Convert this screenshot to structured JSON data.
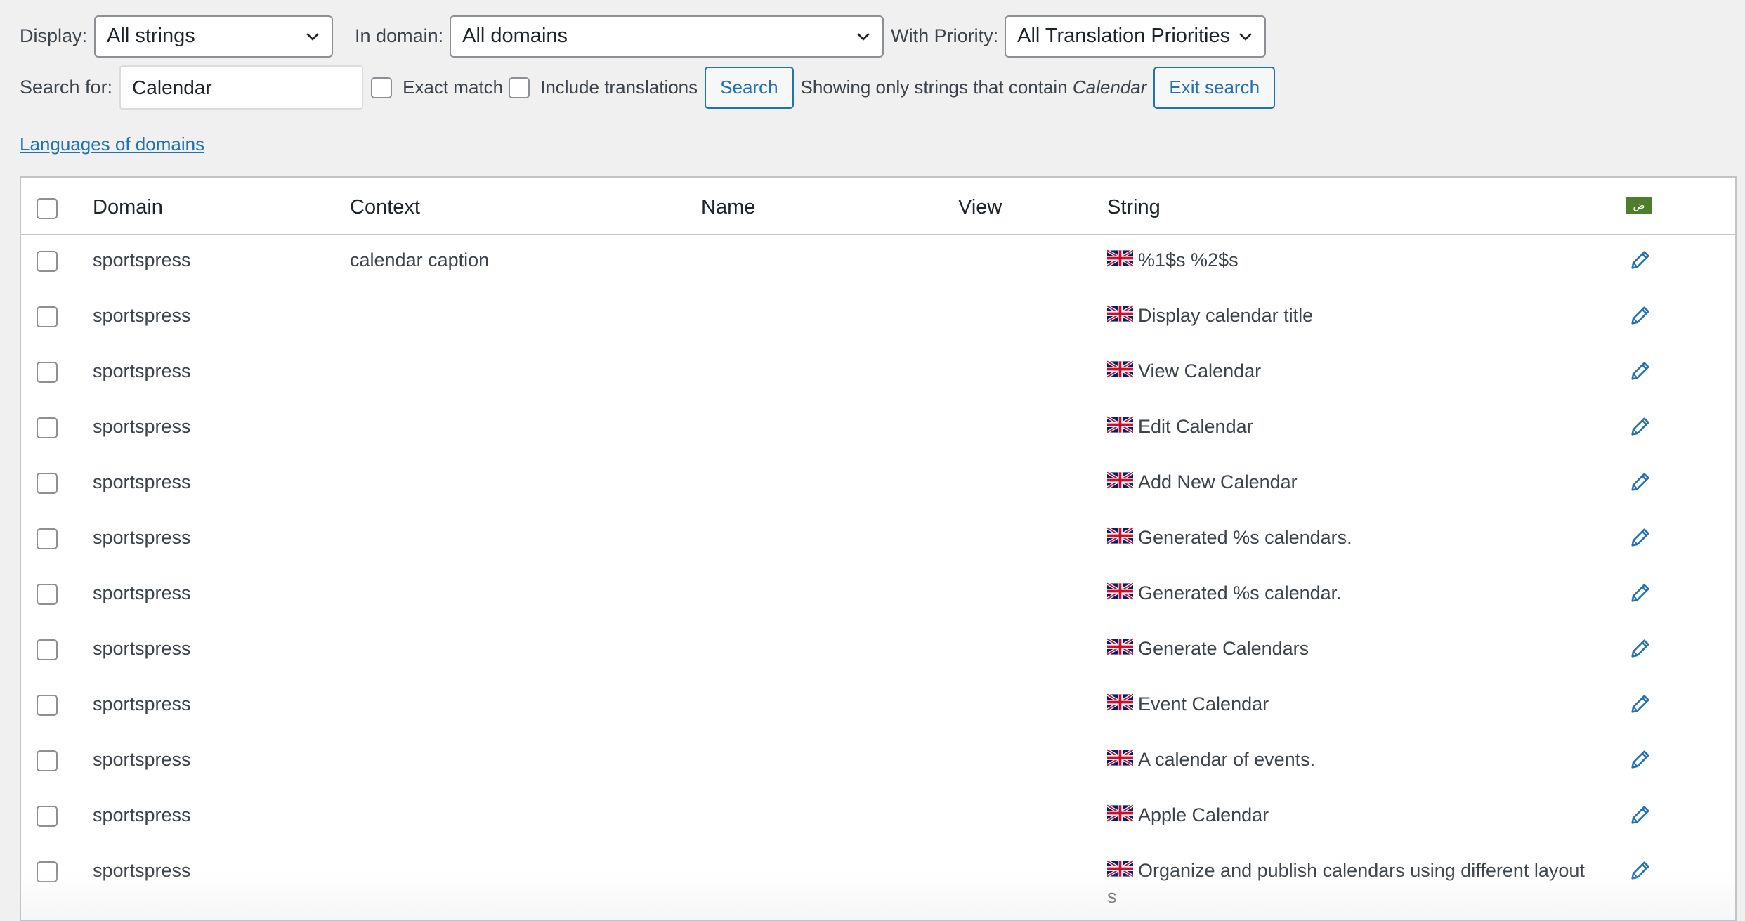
{
  "filters": {
    "display_label": "Display:",
    "display_value": "All strings",
    "domain_label": "In domain:",
    "domain_value": "All domains",
    "priority_label": "With Priority:",
    "priority_value": "All Translation Priorities"
  },
  "search": {
    "label": "Search for:",
    "value": "Calendar",
    "exact_match_label": "Exact match",
    "include_translations_label": "Include translations",
    "search_button": "Search",
    "showing_text": "Showing only strings that contain",
    "showing_term": "Calendar",
    "exit_button": "Exit search"
  },
  "languages_link": "Languages of domains",
  "table": {
    "headers": {
      "domain": "Domain",
      "context": "Context",
      "name": "Name",
      "view": "View",
      "string": "String",
      "language_badge": "ض"
    },
    "rows": [
      {
        "domain": "sportspress",
        "context": "calendar caption",
        "name": "",
        "view": "",
        "string": "%1$s %2$s"
      },
      {
        "domain": "sportspress",
        "context": "",
        "name": "",
        "view": "",
        "string": "Display calendar title"
      },
      {
        "domain": "sportspress",
        "context": "",
        "name": "",
        "view": "",
        "string": "View Calendar"
      },
      {
        "domain": "sportspress",
        "context": "",
        "name": "",
        "view": "",
        "string": "Edit Calendar"
      },
      {
        "domain": "sportspress",
        "context": "",
        "name": "",
        "view": "",
        "string": "Add New Calendar"
      },
      {
        "domain": "sportspress",
        "context": "",
        "name": "",
        "view": "",
        "string": "Generated %s calendars."
      },
      {
        "domain": "sportspress",
        "context": "",
        "name": "",
        "view": "",
        "string": "Generated %s calendar."
      },
      {
        "domain": "sportspress",
        "context": "",
        "name": "",
        "view": "",
        "string": "Generate Calendars"
      },
      {
        "domain": "sportspress",
        "context": "",
        "name": "",
        "view": "",
        "string": "Event Calendar"
      },
      {
        "domain": "sportspress",
        "context": "",
        "name": "",
        "view": "",
        "string": "A calendar of events."
      },
      {
        "domain": "sportspress",
        "context": "",
        "name": "",
        "view": "",
        "string": "Apple Calendar"
      },
      {
        "domain": "sportspress",
        "context": "",
        "name": "",
        "view": "",
        "string": "Organize and publish calendars using different layout",
        "string_wrap": "s"
      }
    ]
  },
  "colors": {
    "accent": "#2271b1",
    "border": "#c3c4c7",
    "background": "#f0f0f1",
    "language_badge": "#4e7d2c"
  },
  "icons": {
    "row_flag": "uk-flag-icon",
    "row_action": "pencil-edit-icon",
    "select": "chevron-down-icon"
  }
}
